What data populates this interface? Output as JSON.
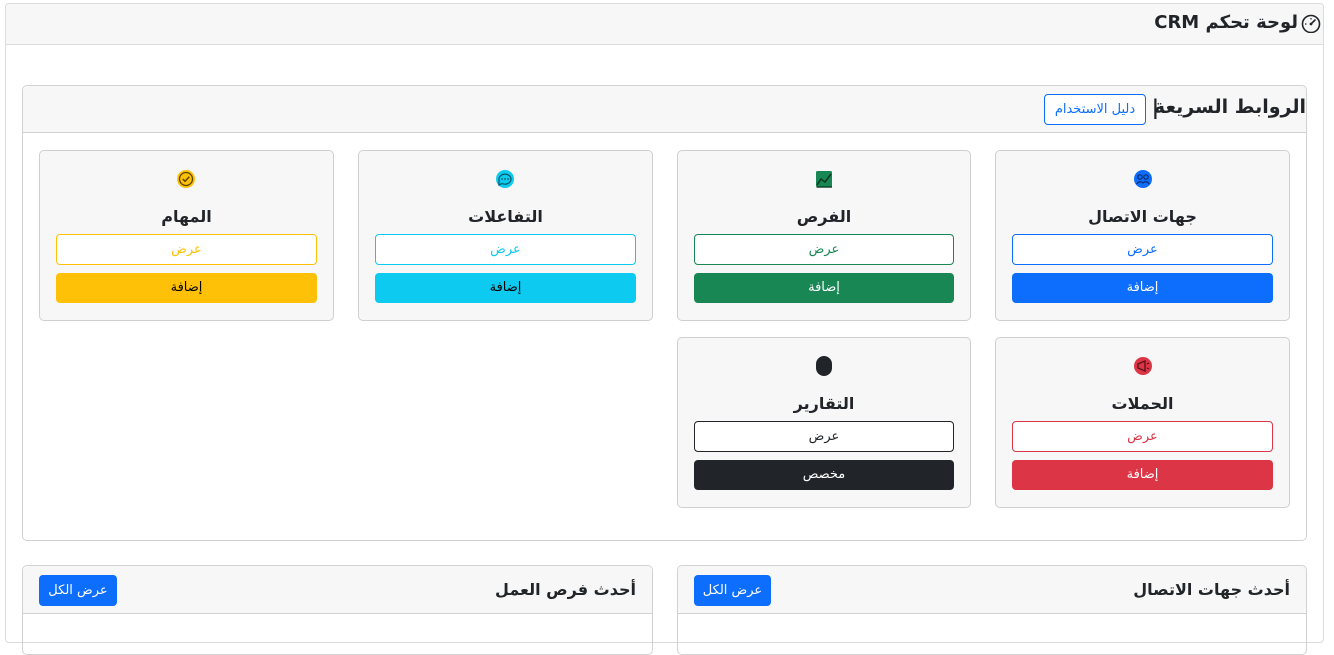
{
  "header": {
    "title": "لوحة تحكم CRM",
    "icon": "gauge-icon"
  },
  "quick_links": {
    "title": "الروابط السريعة",
    "separator": "|",
    "guide_label": "دليل الاستخدام",
    "cards": [
      {
        "title": "جهات الاتصال",
        "icon": "contacts-icon",
        "color": "#0d6efd",
        "view_label": "عرض",
        "action_label": "إضافة"
      },
      {
        "title": "الفرص",
        "icon": "chart-icon",
        "color": "#198754",
        "view_label": "عرض",
        "action_label": "إضافة"
      },
      {
        "title": "التفاعلات",
        "icon": "chat-icon",
        "color": "#0dcaf0",
        "view_label": "عرض",
        "action_label": "إضافة"
      },
      {
        "title": "المهام",
        "icon": "check-circle-icon",
        "color": "#ffc107",
        "view_label": "عرض",
        "action_label": "إضافة"
      },
      {
        "title": "الحملات",
        "icon": "megaphone-icon",
        "color": "#dc3545",
        "view_label": "عرض",
        "action_label": "إضافة"
      },
      {
        "title": "التقارير",
        "icon": "report-icon",
        "color": "#212529",
        "view_label": "عرض",
        "action_label": "مخصص"
      }
    ]
  },
  "recent_contacts": {
    "title": "أحدث جهات الاتصال",
    "view_all_label": "عرض الكل"
  },
  "recent_opportunities": {
    "title": "أحدث فرص العمل",
    "view_all_label": "عرض الكل"
  }
}
